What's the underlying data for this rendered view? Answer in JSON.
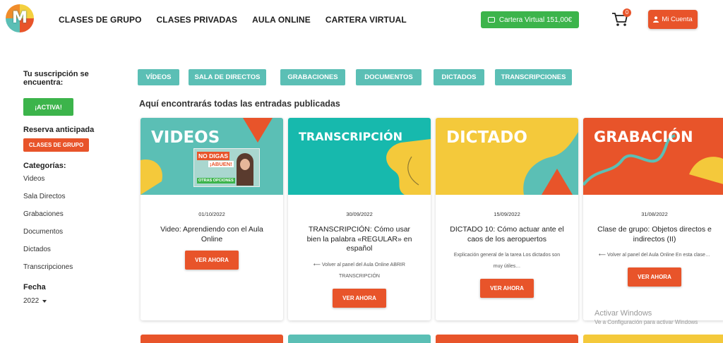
{
  "header": {
    "logo": "M",
    "nav": [
      "CLASES DE GRUPO",
      "CLASES PRIVADAS",
      "AULA ONLINE",
      "CARTERA VIRTUAL"
    ],
    "wallet_label": "Cartera Virtual 151,00€",
    "cart_count": "0",
    "account_label": "Mi Cuenta"
  },
  "sidebar": {
    "subscription_label": "Tu suscripción se encuentra:",
    "status_button": "¡ACTIVA!",
    "reserve_label": "Reserva anticipada",
    "reserve_button": "CLASES DE GRUPO",
    "categories_label": "Categorías:",
    "categories": [
      "Videos",
      "Sala Directos",
      "Grabaciones",
      "Documentos",
      "Dictados",
      "Transcripciones"
    ],
    "date_label": "Fecha",
    "year": "2022"
  },
  "tabs": [
    "VÍDEOS",
    "SALA DE DIRECTOS",
    "GRABACIONES",
    "DOCUMENTOS",
    "DICTADOS",
    "TRANSCRIPCIONES"
  ],
  "intro": "Aquí encontrarás todas las entradas publicadas",
  "cards": [
    {
      "banner_title": "VIDEOS",
      "thumb_title_1": "NO DIGAS",
      "thumb_title_2": "¡ABUEN!",
      "thumb_caption": "OTRAS OPCIONES",
      "date": "01/10/2022",
      "title": "Video: Aprendiendo con el Aula Online",
      "excerpt": "",
      "button": "VER AHORA",
      "color_bg": "#5bbfb5"
    },
    {
      "banner_title": "TRANSCRIPCIÓN",
      "date": "30/09/2022",
      "title": "TRANSCRIPCIÓN: Cómo usar bien la palabra «REGULAR» en español",
      "excerpt": "⟵ Volver al panel del Aula Online ABRIR TRANSCRIPCIÓN",
      "button": "VER AHORA",
      "color_bg": "#17b9ad"
    },
    {
      "banner_title": "DICTADO",
      "date": "15/09/2022",
      "title": "DICTADO 10: Cómo actuar ante el caos de los aeropuertos",
      "excerpt": "Explicación general de la tarea Los dictados son muy útiles…",
      "button": "VER AHORA",
      "color_bg": "#f4c93b"
    },
    {
      "banner_title": "GRABACIÓN",
      "date": "31/08/2022",
      "title": "Clase de grupo: Objetos directos e indirectos (II)",
      "excerpt": "⟵ Volver al panel del Aula Online En esta clase…",
      "button": "VER AHORA",
      "color_bg": "#e8542a"
    }
  ],
  "watermark": {
    "title": "Activar Windows",
    "subtitle": "Ve a Configuración para activar Windows"
  },
  "colors": {
    "accent_orange": "#e8542a",
    "accent_teal": "#5bbfb5",
    "accent_green": "#3cb44b",
    "accent_yellow": "#f4c93b"
  }
}
